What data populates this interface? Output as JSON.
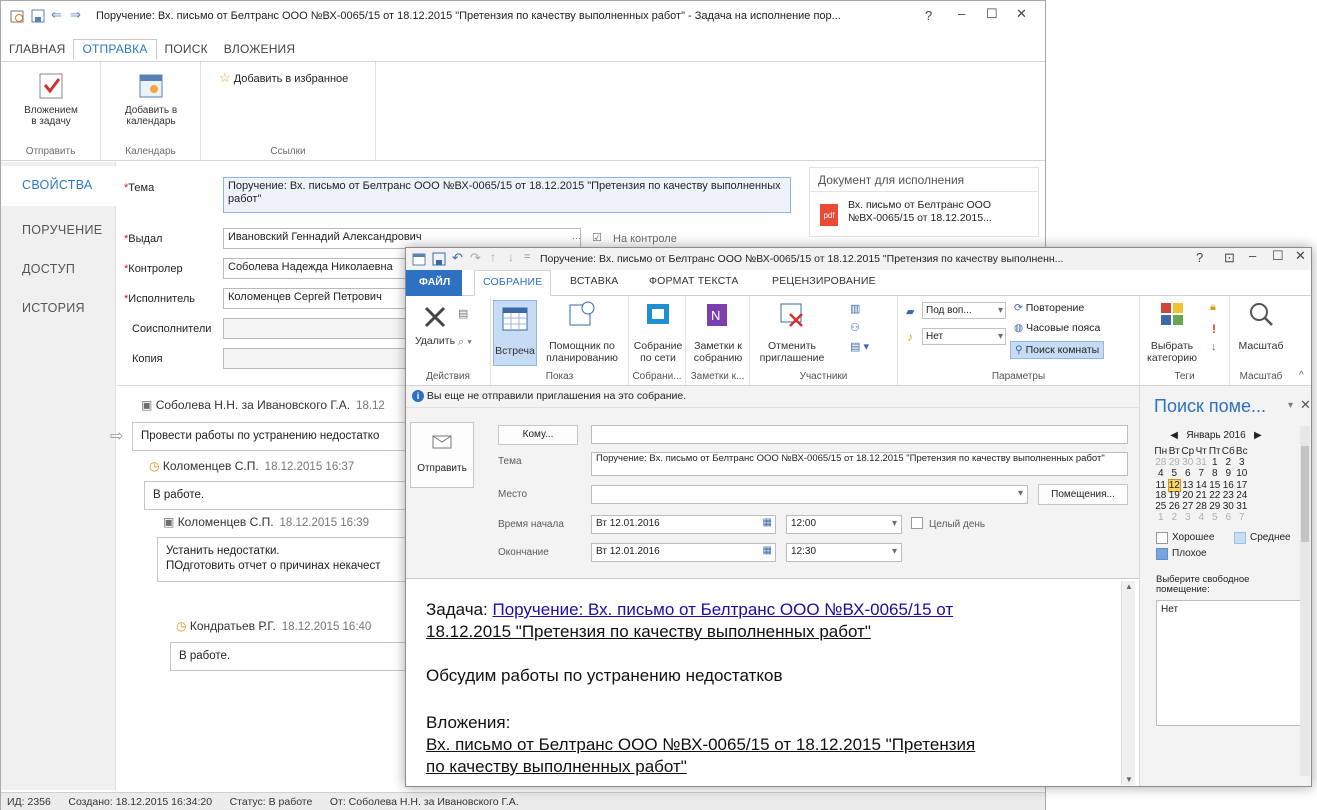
{
  "task_window": {
    "title": "Поручение: Вх. письмо от Белтранс ООО №ВХ-0065/15 от 18.12.2015 \"Претензия по качеству выполненных работ\" - Задача на исполнение пор...",
    "help": "?",
    "tabs": [
      "ГЛАВНАЯ",
      "ОТПРАВКА",
      "ПОИСК",
      "ВЛОЖЕНИЯ"
    ],
    "ribbon": {
      "attach_btn": "Вложением в задачу",
      "calendar_btn": "Добавить в календарь",
      "favorite_btn": "Добавить в избранное",
      "group_send": "Отправить",
      "group_calendar": "Календарь",
      "group_links": "Ссылки"
    },
    "nav": [
      "СВОЙСТВА",
      "ПОРУЧЕНИЕ",
      "ДОСТУП",
      "ИСТОРИЯ"
    ],
    "fields": {
      "subject_label": "Тема",
      "subject_value": "Поручение: Вх. письмо от Белтранс ООО №ВХ-0065/15 от 18.12.2015 \"Претензия по качеству выполненных работ\"",
      "issued_label": "Выдал",
      "issued_value": "Ивановский Геннадий Александрович",
      "on_control": "На контроле",
      "controller_label": "Контролер",
      "controller_value": "Соболева Надежда Николаевна",
      "executor_label": "Исполнитель",
      "executor_value": "Коломенцев Сергей Петрович",
      "coexecutors_label": "Соисполнители",
      "copy_label": "Копия"
    },
    "doc_panel": {
      "title": "Документ для исполнения",
      "icon_text": "pdf",
      "doc_line1": "Вх. письмо от Белтранс ООО",
      "doc_line2": "№ВХ-0065/15 от 18.12.2015..."
    },
    "messages": [
      {
        "author": "Соболева Н.Н. за Ивановского Г.А.",
        "date": "18.12",
        "text": "Провести работы по устранению недостатко"
      },
      {
        "author": "Коломенцев С.П.",
        "date": "18.12.2015 16:37",
        "text": "В работе."
      },
      {
        "author": "Коломенцев С.П.",
        "date": "18.12.2015 16:39",
        "text1": "Устанить недостатки.",
        "text2": "ПОдготовить отчет о причинах некачест"
      },
      {
        "author": "Кондратьев Р.Г.",
        "date": "18.12.2015 16:40",
        "text": "В работе."
      }
    ],
    "status": {
      "id": "ИД: 2356",
      "created": "Создано: 18.12.2015 16:34:20",
      "state": "Статус: В работе",
      "from": "От: Соболева Н.Н. за Ивановского Г.А."
    }
  },
  "meeting_window": {
    "title": "Поручение: Вх. письмо от Белтранс ООО №ВХ-0065/15 от 18.12.2015 \"Претензия по качеству выполненн...",
    "help": "?",
    "tabs": [
      "ФАЙЛ",
      "СОБРАНИЕ",
      "ВСТАВКА",
      "ФОРМАТ ТЕКСТА",
      "РЕЦЕНЗИРОВАНИЕ"
    ],
    "ribbon": {
      "delete": "Удалить",
      "meeting": "Встреча",
      "scheduling1": "Помощник по",
      "scheduling2": "планированию",
      "online1": "Собрание",
      "online2": "по сети",
      "notes1": "Заметки к",
      "notes2": "собранию",
      "cancel1": "Отменить",
      "cancel2": "приглашение",
      "show_as": "Под воп...",
      "reminder": "Нет",
      "recurrence": "Повторение",
      "timezones": "Часовые пояса",
      "room_finder": "Поиск комнаты",
      "categorize1": "Выбрать",
      "categorize2": "категорию",
      "zoom": "Масштаб",
      "groups": [
        "Действия",
        "Показ",
        "Собрани...",
        "Заметки к...",
        "Участники",
        "Параметры",
        "Теги",
        "Масштаб"
      ]
    },
    "info": "Вы еще не отправили приглашения на это собрание.",
    "send": "Отправить",
    "to_btn": "Кому...",
    "subject_label": "Тема",
    "subject_value": "Поручение: Вх. письмо от Белтранс ООО №ВХ-0065/15 от 18.12.2015 \"Претензия по качеству выполненных работ\"",
    "location_label": "Место",
    "rooms_btn": "Помещения...",
    "start_label": "Время начала",
    "start_date": "Вт 12.01.2016",
    "start_time": "12:00",
    "allday": "Целый день",
    "end_label": "Окончание",
    "end_date": "Вт 12.01.2016",
    "end_time": "12:30",
    "body": {
      "task_prefix": "Задача: ",
      "task_link1": "Поручение: Вх. письмо от Белтранс ООО №ВХ-0065/15 от",
      "task_link2": "18.12.2015 \"Претензия по качеству выполненных работ\"",
      "discuss": "Обсудим работы по устранению недостатков",
      "attachments": "Вложения:",
      "att_link1": "Вх. письмо от Белтранс ООО №ВХ-0065/15 от 18.12.2015 \"Претензия",
      "att_link2": "по качеству выполненных работ\""
    },
    "room_pane": {
      "title": "Поиск поме...",
      "month": "Январь 2016",
      "weekdays": [
        "Пн",
        "Вт",
        "Ср",
        "Чт",
        "Пт",
        "Сб",
        "Вс"
      ],
      "weeks": [
        [
          "28",
          "29",
          "30",
          "31",
          "1",
          "2",
          "3"
        ],
        [
          "4",
          "5",
          "6",
          "7",
          "8",
          "9",
          "10"
        ],
        [
          "11",
          "12",
          "13",
          "14",
          "15",
          "16",
          "17"
        ],
        [
          "18",
          "19",
          "20",
          "21",
          "22",
          "23",
          "24"
        ],
        [
          "25",
          "26",
          "27",
          "28",
          "29",
          "30",
          "31"
        ],
        [
          "1",
          "2",
          "3",
          "4",
          "5",
          "6",
          "7"
        ]
      ],
      "legend_good": "Хорошее",
      "legend_fair": "Среднее",
      "legend_poor": "Плохое",
      "choose_room": "Выберите свободное помещение:",
      "room_value": "Нет"
    }
  },
  "colors": {
    "accent": "#2b79c8",
    "file_tab": "#2d71c0",
    "selected": "#c5dcf4",
    "today": "#f6d36b"
  }
}
